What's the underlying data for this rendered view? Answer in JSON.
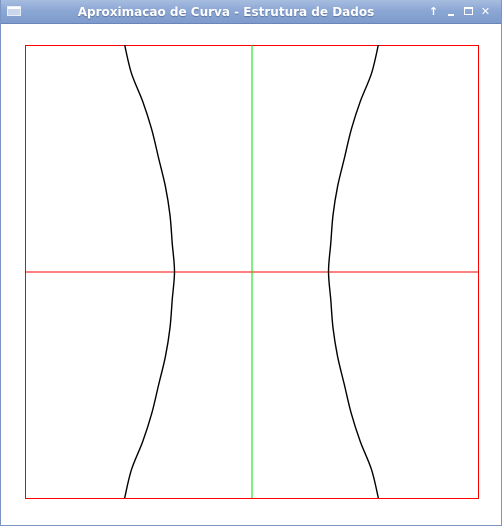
{
  "window": {
    "title": "Aproximacao de Curva - Estrutura de Dados",
    "buttons": {
      "up_icon": "arrow-up-icon",
      "minimize_icon": "minimize-icon",
      "maximize_icon": "maximize-icon",
      "close_icon": "close-icon"
    }
  },
  "colors": {
    "titlebar": "#8ca7d4",
    "frame": "#ff0000",
    "horizontal_axis": "#ff0000",
    "vertical_axis": "#00dd00",
    "curve": "#000000"
  },
  "chart_data": {
    "type": "line",
    "title": "",
    "xlabel": "",
    "ylabel": "",
    "xlim": [
      -1,
      1
    ],
    "ylim": [
      -1,
      1
    ],
    "grid": false,
    "series": [
      {
        "x": [
          -0.56,
          -0.53,
          -0.48,
          -0.44,
          -0.41,
          -0.38,
          -0.36,
          -0.35,
          -0.34,
          -0.35,
          -0.36,
          -0.38,
          -0.41,
          -0.44,
          -0.48,
          -0.53,
          -0.56
        ],
        "y": [
          1.0,
          0.875,
          0.75,
          0.625,
          0.5,
          0.375,
          0.25,
          0.125,
          0.0,
          -0.125,
          -0.25,
          -0.375,
          -0.5,
          -0.625,
          -0.75,
          -0.875,
          -1.0
        ]
      },
      {
        "x": [
          0.56,
          0.53,
          0.48,
          0.44,
          0.41,
          0.38,
          0.36,
          0.35,
          0.34,
          0.35,
          0.36,
          0.38,
          0.41,
          0.44,
          0.48,
          0.53,
          0.56
        ],
        "y": [
          1.0,
          0.875,
          0.75,
          0.625,
          0.5,
          0.375,
          0.25,
          0.125,
          0.0,
          -0.125,
          -0.25,
          -0.375,
          -0.5,
          -0.625,
          -0.75,
          -0.875,
          -1.0
        ]
      }
    ]
  }
}
